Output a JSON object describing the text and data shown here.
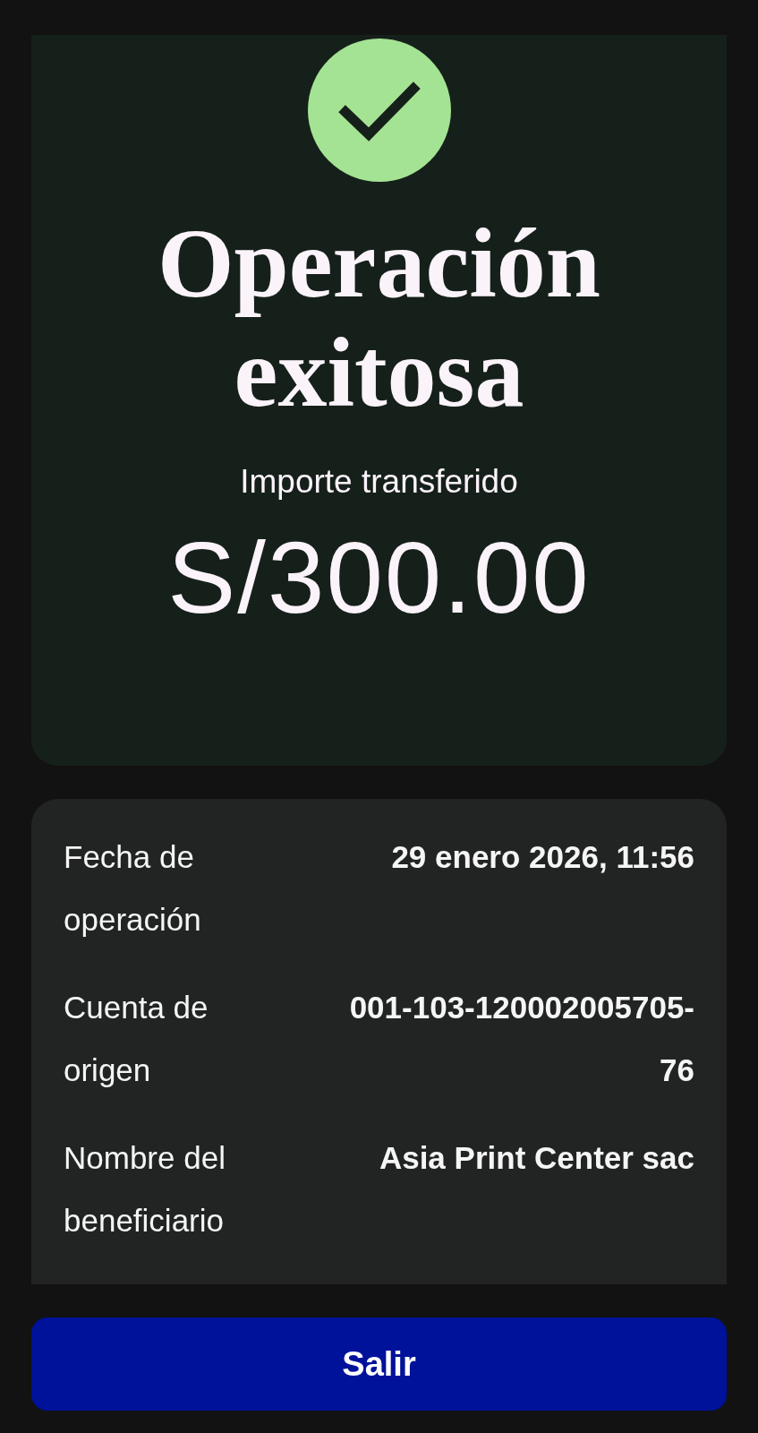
{
  "result": {
    "title": "Operación exitosa",
    "amount_label": "Importe transferido",
    "amount": "S/300.00"
  },
  "details": [
    {
      "label": "Fecha de operación",
      "value": "29 enero 2026, 11:56"
    },
    {
      "label": "Cuenta de origen",
      "value": "001-103-120002005705-76"
    },
    {
      "label": "Nombre del beneficiario",
      "value": "Asia Print Center sac"
    }
  ],
  "button": "Salir"
}
